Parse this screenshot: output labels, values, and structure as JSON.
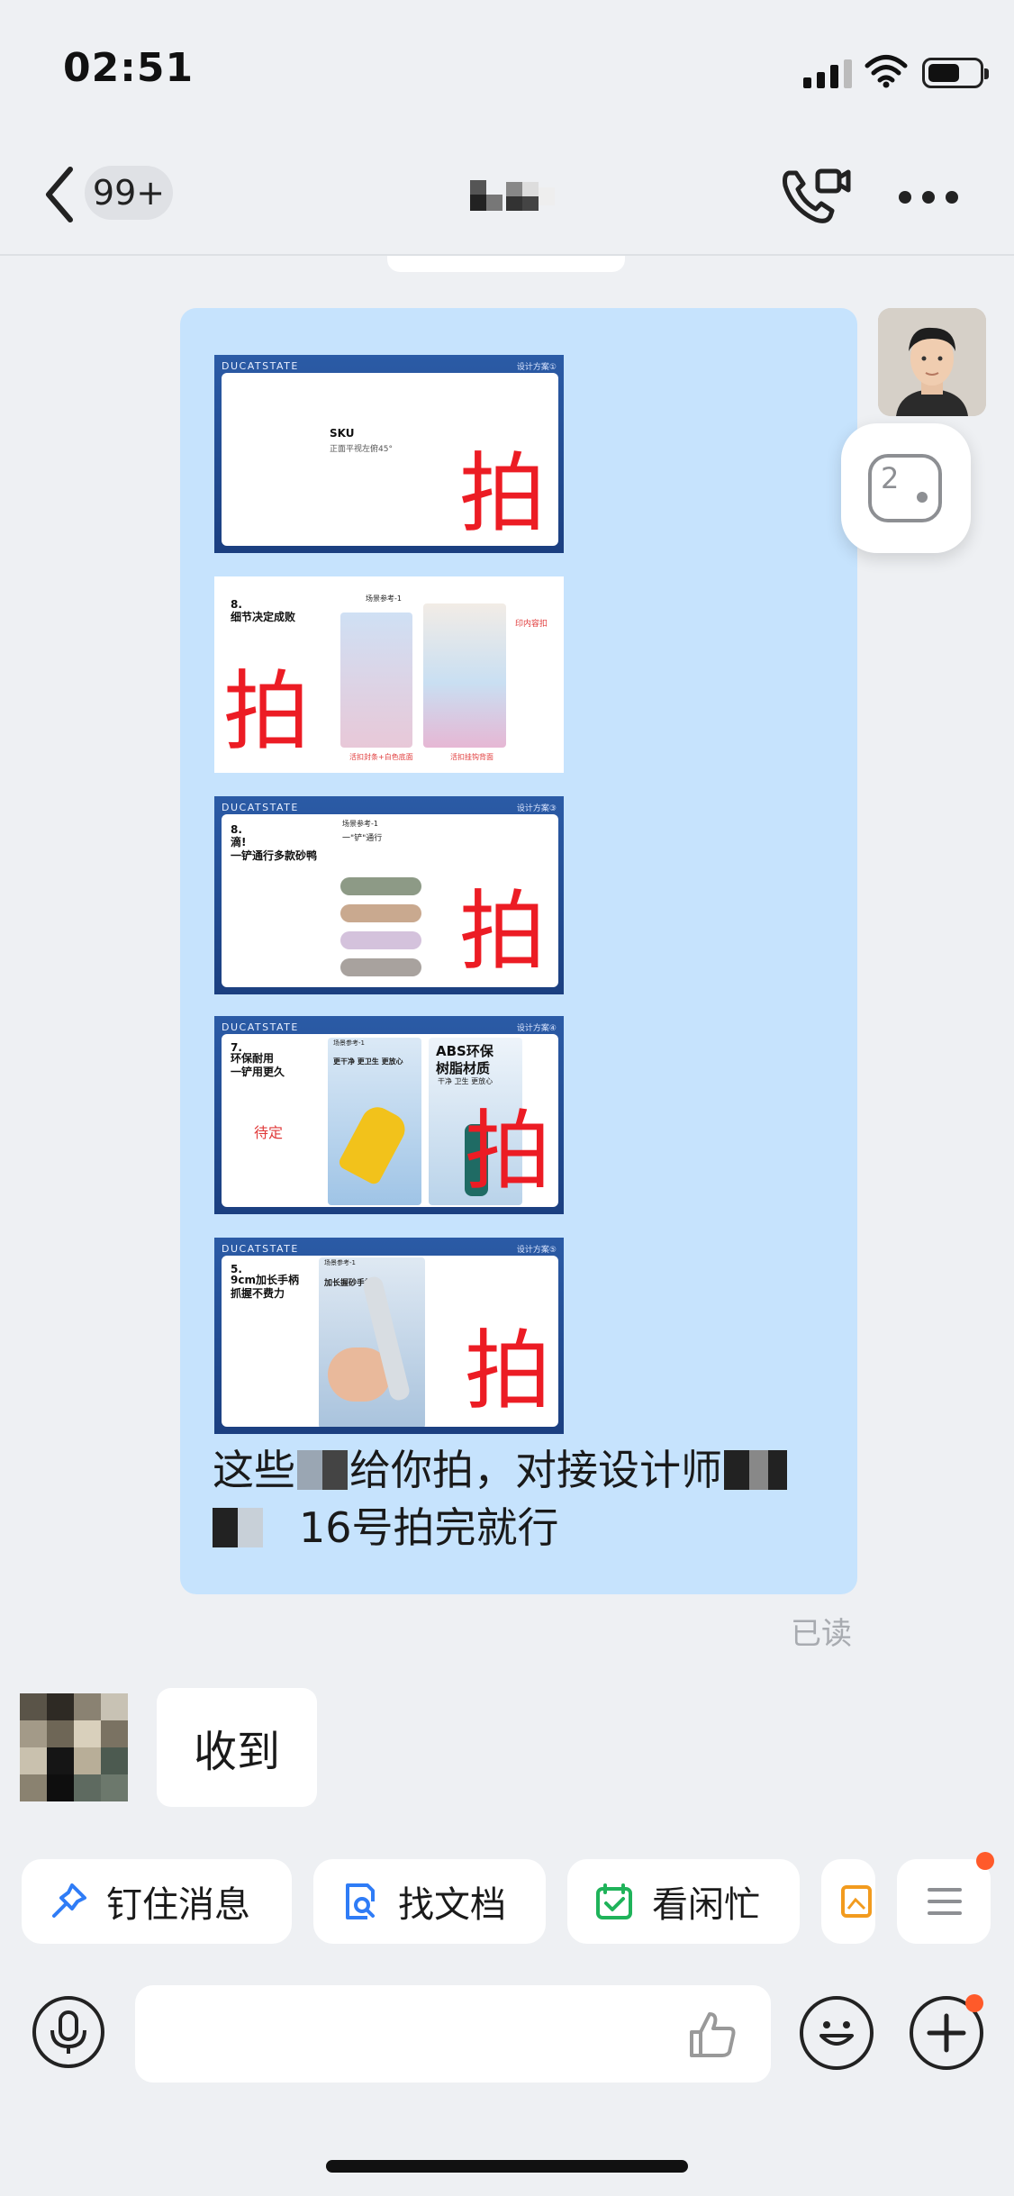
{
  "status_bar": {
    "time": "02:51"
  },
  "header": {
    "unread_badge": "99+"
  },
  "sent_message": {
    "slides": [
      {
        "brand": "DUCATSTATE",
        "tag": "设计方案①",
        "heading": "SKU",
        "sub": "正面平视左俯45°",
        "overlay": "拍"
      },
      {
        "number": "8.",
        "heading": "细节决定成败",
        "ref": "场景参考-1",
        "caption_left": "活扣封条+白色底面",
        "caption_right": "活扣挂钩背面",
        "side_note": "印内容扣",
        "overlay": "拍"
      },
      {
        "brand": "DUCATSTATE",
        "tag": "设计方案③",
        "number": "8.",
        "heading": "滴!\n一铲通行多款砂鸭",
        "ref": "场景参考-1",
        "sub": "一\"铲\"通行",
        "overlay": "拍"
      },
      {
        "brand": "DUCATSTATE",
        "tag": "设计方案④",
        "number": "7.",
        "heading": "环保耐用\n一铲用更久",
        "ref": "场景参考-1",
        "line1": "更干净 更卫生 更放心",
        "material": "ABS环保\n树脂材质",
        "material_sub": "干净 卫生 更放心",
        "pending": "待定",
        "overlay": "拍"
      },
      {
        "brand": "DUCATSTATE",
        "tag": "设计方案⑤",
        "number": "5.",
        "heading": "9cm加长手柄\n抓握不费力",
        "ref": "场景参考-1",
        "sub": "加长握砂手柄",
        "overlay": "拍"
      }
    ],
    "text_line1_a": "这些",
    "text_line1_b": "给你拍，对接设计师",
    "text_line2": "16号拍完就行",
    "status": "已读"
  },
  "received_message": {
    "text": "收到"
  },
  "quick_actions": [
    {
      "label": "钉住消息",
      "icon": "pin-icon",
      "color": "#2f7cf6"
    },
    {
      "label": "找文档",
      "icon": "doc-search-icon",
      "color": "#2f7cf6"
    },
    {
      "label": "看闲忙",
      "icon": "calendar-check-icon",
      "color": "#1fb35a"
    }
  ],
  "floating_counter": "2",
  "colors": {
    "accent": "#ec1c24",
    "bubble_me": "#c6e3fd",
    "background": "#eef0f3",
    "notify_dot": "#ff5a2a"
  }
}
